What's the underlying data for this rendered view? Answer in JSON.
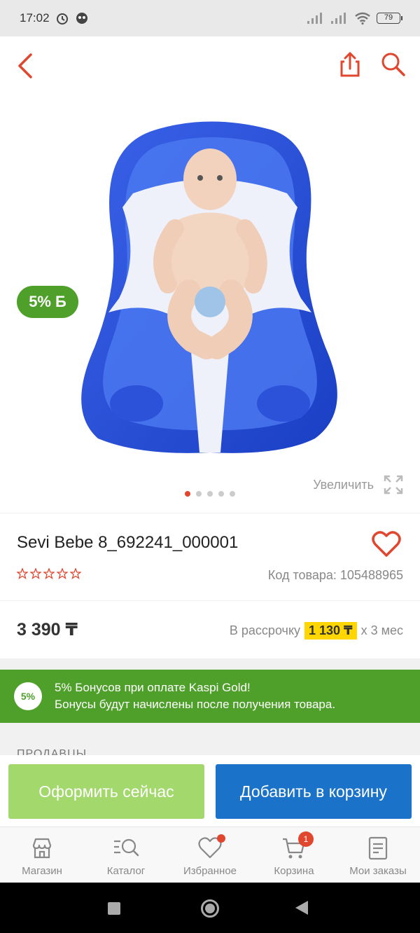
{
  "status_bar": {
    "time": "17:02",
    "battery": "79"
  },
  "colors": {
    "accent_red": "#e0472e",
    "kaspi_green": "#4ea02a",
    "cart_blue": "#1a73c9",
    "buy_now_green": "#a3d86c",
    "installment_yellow": "#ffd600"
  },
  "topnav": {
    "back_icon": "chevron-left-icon",
    "share_icon": "share-icon",
    "search_icon": "search-icon"
  },
  "gallery": {
    "bonus_badge": "5%",
    "bonus_badge_symbol": "Б",
    "zoom_label": "Увеличить",
    "image_count": 5,
    "active_image": 1
  },
  "product": {
    "title": "Sevi Bebe 8_692241_000001",
    "code_label": "Код товара: 105488965",
    "rating_stars": 0,
    "rating_max": 5
  },
  "price": {
    "value": "3 390 ₸",
    "installment_prefix": "В рассрочку",
    "installment_amount": "1 130 ₸",
    "installment_suffix": "x 3 мес"
  },
  "promo": {
    "circle": "5%",
    "line1": "5% Бонусов при оплате Kaspi Gold!",
    "line2": "Бонусы будут начислены после получения товара."
  },
  "sellers": {
    "label": "ПРОДАВЦЫ"
  },
  "actions": {
    "buy_now": "Оформить сейчас",
    "add_to_cart": "Добавить в корзину"
  },
  "tabbar": {
    "shop": "Магазин",
    "catalog": "Каталог",
    "favorites": "Избранное",
    "cart": "Корзина",
    "cart_badge": "1",
    "orders": "Мои заказы"
  }
}
